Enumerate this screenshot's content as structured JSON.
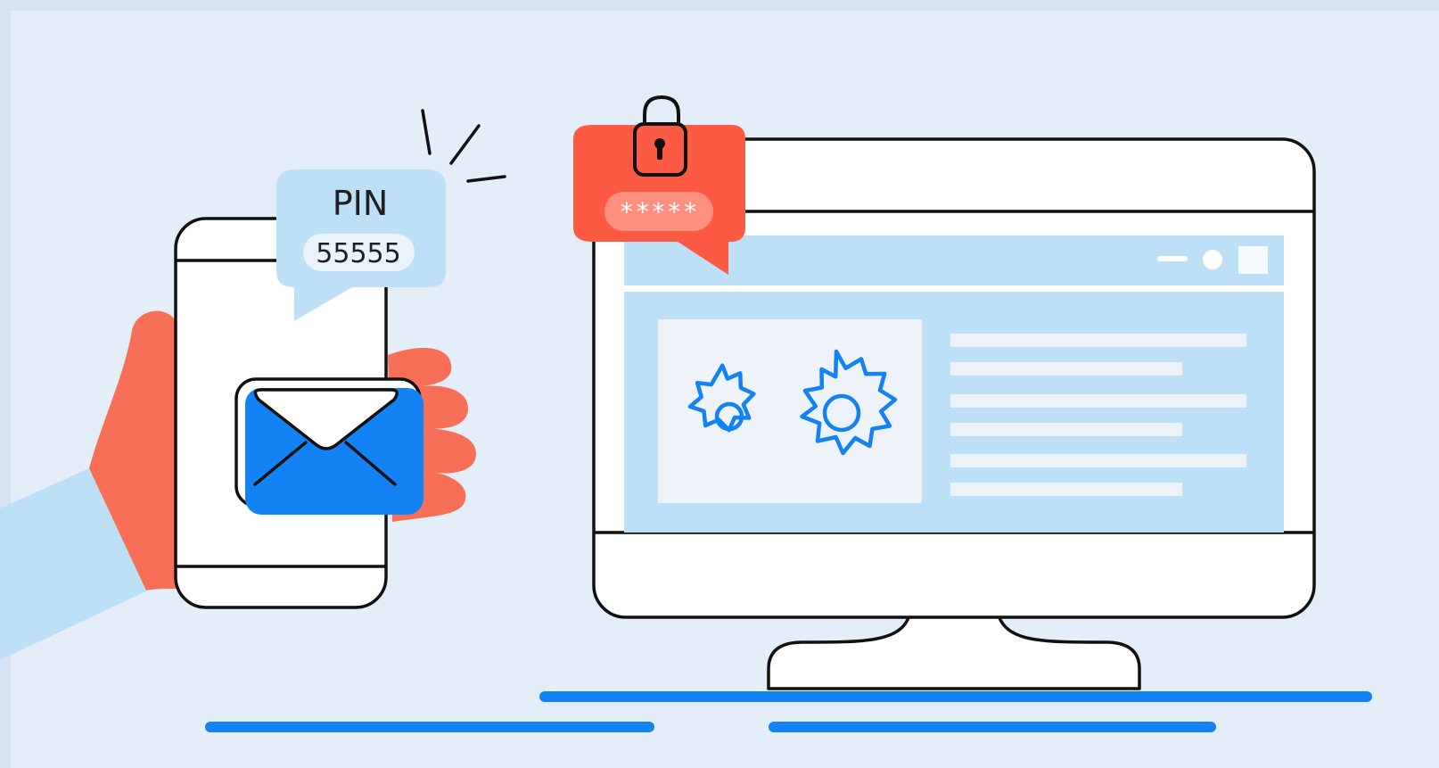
{
  "pin_bubble": {
    "title": "PIN",
    "code": "55555"
  },
  "password_bubble": {
    "mask": "*****"
  },
  "icons": {
    "envelope": "envelope-icon",
    "padlock": "padlock-open-icon",
    "gear": "gear-icon"
  },
  "colors": {
    "background": "#e3eef9",
    "frame": "#d6e3f0",
    "accent_blue": "#1282f5",
    "light_blue": "#bde0f7",
    "coral": "#fd5a43",
    "skin": "#f76f57",
    "outline": "#111111",
    "white": "#ffffff"
  }
}
